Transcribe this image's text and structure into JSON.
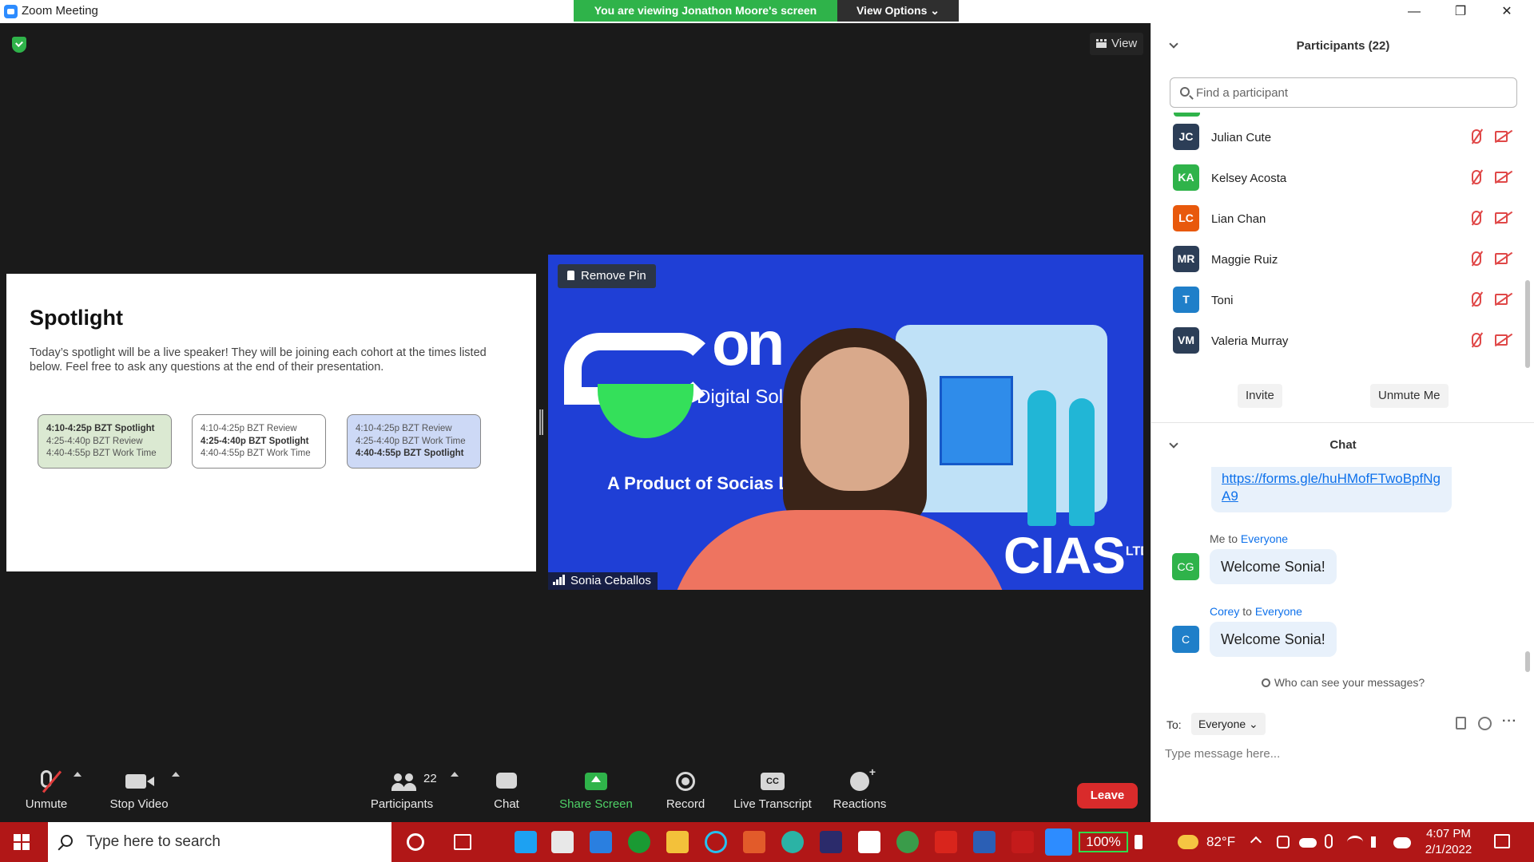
{
  "window": {
    "title": "Zoom Meeting",
    "viewing_banner": "You are viewing Jonathon Moore's screen",
    "view_options": "View Options ⌄",
    "controls": {
      "minimize": "—",
      "restore": "❐",
      "close": "✕"
    }
  },
  "meeting": {
    "view_button": "View",
    "slide": {
      "title": "Spotlight",
      "body": "Today’s spotlight will be a live speaker! They will be joining each cohort at the times listed below. Feel free to ask any questions at the end of their presentation.",
      "cohorts": [
        {
          "lines": [
            "4:10-4:25p BZT Spotlight",
            "4:25-4:40p BZT Review",
            "4:40-4:55p BZT Work Time"
          ],
          "bold_index": 0
        },
        {
          "lines": [
            "4:10-4:25p BZT Review",
            "4:25-4:40p BZT Spotlight",
            "4:40-4:55p BZT Work Time"
          ],
          "bold_index": 1
        },
        {
          "lines": [
            "4:10-4:25p BZT Review",
            "4:25-4:40p BZT Work Time",
            "4:40-4:55p BZT Spotlight"
          ],
          "bold_index": 2
        }
      ]
    },
    "video": {
      "remove_pin": "Remove Pin",
      "participant_name": "Sonia Ceballos",
      "background_text": {
        "on": "on",
        "digital": "Digital Sol",
        "product": "A Product of Socias LT",
        "socias": "CIAS",
        "ltd": "LTD"
      }
    },
    "toolbar": {
      "unmute": "Unmute",
      "stop_video": "Stop Video",
      "participants": "Participants",
      "participants_count": "22",
      "chat": "Chat",
      "share_screen": "Share Screen",
      "record": "Record",
      "live_transcript": "Live Transcript",
      "cc_icon": "CC",
      "reactions": "Reactions",
      "leave": "Leave"
    }
  },
  "participants_panel": {
    "title": "Participants (22)",
    "search_placeholder": "Find a participant",
    "participants": [
      {
        "initials": "JC",
        "name": "Julian Cute",
        "color": "#2c3e57"
      },
      {
        "initials": "KA",
        "name": "Kelsey Acosta",
        "color": "#2fb34a"
      },
      {
        "initials": "LC",
        "name": "Lian Chan",
        "color": "#e8590c"
      },
      {
        "initials": "MR",
        "name": "Maggie Ruiz",
        "color": "#2c3e57"
      },
      {
        "initials": "T",
        "name": "Toni",
        "color": "#1f7fc9"
      },
      {
        "initials": "VM",
        "name": "Valeria Murray",
        "color": "#2c3e57"
      }
    ],
    "invite": "Invite",
    "unmute_me": "Unmute Me"
  },
  "chat_panel": {
    "title": "Chat",
    "link_text": "https://forms.gle/huHMofFTwoBpfNgA9",
    "messages": [
      {
        "sender": "Me",
        "to_word": "to",
        "recipient": "Everyone",
        "initials": "CG",
        "avatar_color": "#2fb34a",
        "text": "Welcome Sonia!"
      },
      {
        "sender": "Corey",
        "to_word": "to",
        "recipient": "Everyone",
        "initials": "C",
        "avatar_color": "#1f7fc9",
        "text": "Welcome Sonia!"
      }
    ],
    "who_can_see": "Who can see your messages?",
    "to_label": "To:",
    "to_value": "Everyone ⌄",
    "more": "···",
    "input_placeholder": "Type message here..."
  },
  "taskbar": {
    "search_placeholder": "Type here to search",
    "battery": "100%",
    "temperature": "82°F",
    "time": "4:07 PM",
    "date": "2/1/2022",
    "app_icons": [
      "cortana-icon",
      "task-view-icon",
      "l-app-icon",
      "store-icon",
      "mail-icon",
      "xbox-icon",
      "file-explorer-icon",
      "alexa-icon",
      "office-icon",
      "edge-icon",
      "webex-icon",
      "slack-icon",
      "chrome-icon",
      "acrobat-icon",
      "word-icon",
      "mcafee-icon",
      "zoom-icon"
    ]
  }
}
